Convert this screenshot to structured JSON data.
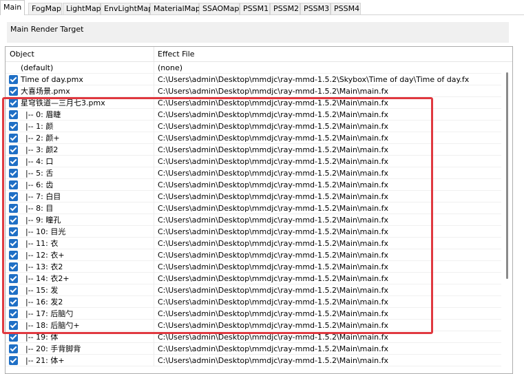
{
  "tabs": [
    "Main",
    "FogMap",
    "LightMap",
    "EnvLightMap",
    "MaterialMap",
    "SSAOMap",
    "PSSM1",
    "PSSM2",
    "PSSM3",
    "PSSM4"
  ],
  "active_tab": "Main",
  "group": {
    "label": "Main Render Target"
  },
  "list": {
    "columns": {
      "object": "Object",
      "effect_file": "Effect File"
    },
    "rows": [
      {
        "checkbox": false,
        "object": "(default)",
        "effect": "(none)"
      },
      {
        "checkbox": true,
        "object": "Time of day.pmx",
        "effect": "C:\\Users\\admin\\Desktop\\mmdjc\\ray-mmd-1.5.2\\Skybox\\Time of day\\Time of day.fx"
      },
      {
        "checkbox": true,
        "object": "大喜场景.pmx",
        "effect": "C:\\Users\\admin\\Desktop\\mmdjc\\ray-mmd-1.5.2\\Main\\main.fx"
      },
      {
        "checkbox": true,
        "object": "星穹铁道—三月七3.pmx",
        "effect": "C:\\Users\\admin\\Desktop\\mmdjc\\ray-mmd-1.5.2\\Main\\main.fx"
      },
      {
        "checkbox": true,
        "object": "  |-- 0: 眉睫",
        "effect": "C:\\Users\\admin\\Desktop\\mmdjc\\ray-mmd-1.5.2\\Main\\main.fx"
      },
      {
        "checkbox": true,
        "object": "  |-- 1: 颜",
        "effect": "C:\\Users\\admin\\Desktop\\mmdjc\\ray-mmd-1.5.2\\Main\\main.fx"
      },
      {
        "checkbox": true,
        "object": "  |-- 2: 颜+",
        "effect": "C:\\Users\\admin\\Desktop\\mmdjc\\ray-mmd-1.5.2\\Main\\main.fx"
      },
      {
        "checkbox": true,
        "object": "  |-- 3: 颜2",
        "effect": "C:\\Users\\admin\\Desktop\\mmdjc\\ray-mmd-1.5.2\\Main\\main.fx"
      },
      {
        "checkbox": true,
        "object": "  |-- 4: 口",
        "effect": "C:\\Users\\admin\\Desktop\\mmdjc\\ray-mmd-1.5.2\\Main\\main.fx"
      },
      {
        "checkbox": true,
        "object": "  |-- 5: 舌",
        "effect": "C:\\Users\\admin\\Desktop\\mmdjc\\ray-mmd-1.5.2\\Main\\main.fx"
      },
      {
        "checkbox": true,
        "object": "  |-- 6: 齿",
        "effect": "C:\\Users\\admin\\Desktop\\mmdjc\\ray-mmd-1.5.2\\Main\\main.fx"
      },
      {
        "checkbox": true,
        "object": "  |-- 7: 白目",
        "effect": "C:\\Users\\admin\\Desktop\\mmdjc\\ray-mmd-1.5.2\\Main\\main.fx"
      },
      {
        "checkbox": true,
        "object": "  |-- 8: 目",
        "effect": "C:\\Users\\admin\\Desktop\\mmdjc\\ray-mmd-1.5.2\\Main\\main.fx"
      },
      {
        "checkbox": true,
        "object": "  |-- 9: 瞳孔",
        "effect": "C:\\Users\\admin\\Desktop\\mmdjc\\ray-mmd-1.5.2\\Main\\main.fx"
      },
      {
        "checkbox": true,
        "object": "  |-- 10: 目光",
        "effect": "C:\\Users\\admin\\Desktop\\mmdjc\\ray-mmd-1.5.2\\Main\\main.fx"
      },
      {
        "checkbox": true,
        "object": "  |-- 11: 衣",
        "effect": "C:\\Users\\admin\\Desktop\\mmdjc\\ray-mmd-1.5.2\\Main\\main.fx"
      },
      {
        "checkbox": true,
        "object": "  |-- 12: 衣+",
        "effect": "C:\\Users\\admin\\Desktop\\mmdjc\\ray-mmd-1.5.2\\Main\\main.fx"
      },
      {
        "checkbox": true,
        "object": "  |-- 13: 衣2",
        "effect": "C:\\Users\\admin\\Desktop\\mmdjc\\ray-mmd-1.5.2\\Main\\main.fx"
      },
      {
        "checkbox": true,
        "object": "  |-- 14: 衣2+",
        "effect": "C:\\Users\\admin\\Desktop\\mmdjc\\ray-mmd-1.5.2\\Main\\main.fx"
      },
      {
        "checkbox": true,
        "object": "  |-- 15: 发",
        "effect": "C:\\Users\\admin\\Desktop\\mmdjc\\ray-mmd-1.5.2\\Main\\main.fx"
      },
      {
        "checkbox": true,
        "object": "  |-- 16: 发2",
        "effect": "C:\\Users\\admin\\Desktop\\mmdjc\\ray-mmd-1.5.2\\Main\\main.fx"
      },
      {
        "checkbox": true,
        "object": "  |-- 17: 后脑勺",
        "effect": "C:\\Users\\admin\\Desktop\\mmdjc\\ray-mmd-1.5.2\\Main\\main.fx"
      },
      {
        "checkbox": true,
        "object": "  |-- 18: 后脑勺+",
        "effect": "C:\\Users\\admin\\Desktop\\mmdjc\\ray-mmd-1.5.2\\Main\\main.fx"
      },
      {
        "checkbox": true,
        "object": "  |-- 19: 体",
        "effect": "C:\\Users\\admin\\Desktop\\mmdjc\\ray-mmd-1.5.2\\Main\\main.fx"
      },
      {
        "checkbox": true,
        "object": "  |-- 20: 手背脚背",
        "effect": "C:\\Users\\admin\\Desktop\\mmdjc\\ray-mmd-1.5.2\\Main\\main.fx"
      },
      {
        "checkbox": true,
        "object": "  |-- 21: 体+",
        "effect": "C:\\Users\\admin\\Desktop\\mmdjc\\ray-mmd-1.5.2\\Main\\main.fx"
      }
    ]
  },
  "colors": {
    "checkbox": "#1f6fc5",
    "highlight_box": "#e0383f"
  }
}
